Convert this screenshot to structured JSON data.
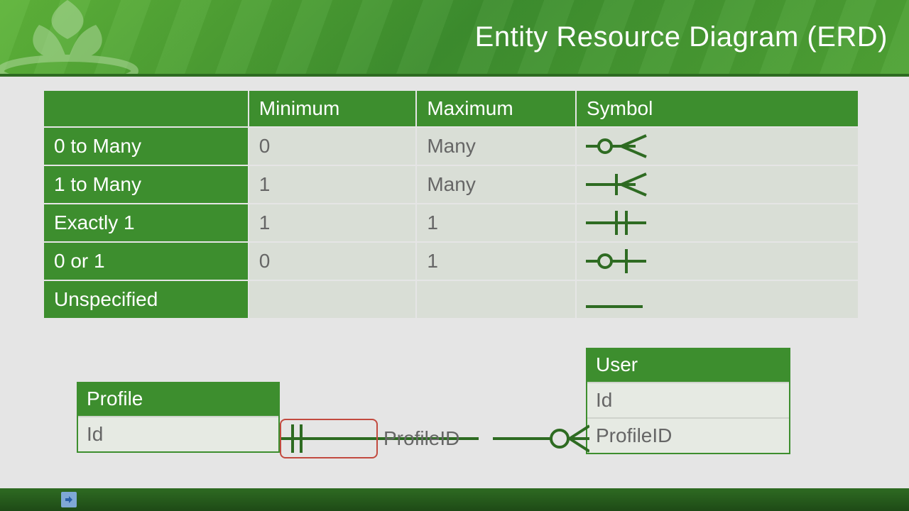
{
  "header": {
    "title": "Entity Resource Diagram (ERD)"
  },
  "table": {
    "headers": [
      "",
      "Minimum",
      "Maximum",
      "Symbol"
    ],
    "rows": [
      {
        "label": "0 to Many",
        "min": "0",
        "max": "Many",
        "symbol": "zero-to-many"
      },
      {
        "label": "1 to Many",
        "min": "1",
        "max": "Many",
        "symbol": "one-to-many"
      },
      {
        "label": "Exactly 1",
        "min": "1",
        "max": "1",
        "symbol": "exactly-one"
      },
      {
        "label": "0 or 1",
        "min": "0",
        "max": "1",
        "symbol": "zero-or-one"
      },
      {
        "label": "Unspecified",
        "min": "",
        "max": "",
        "symbol": "unspecified"
      }
    ]
  },
  "diagram": {
    "entities": {
      "profile": {
        "name": "Profile",
        "attrs": [
          "Id"
        ]
      },
      "user": {
        "name": "User",
        "attrs": [
          "Id",
          "ProfileID"
        ]
      }
    },
    "relationship": {
      "left_cardinality": "exactly-one",
      "right_cardinality": "zero-to-many",
      "mid_label": "ProfileID",
      "highlight": "left"
    }
  },
  "colors": {
    "brand_green": "#3d8e2e",
    "brand_green_light": "#5fb43a",
    "row_bg": "#d9ded6",
    "text_muted": "#666666",
    "highlight_red": "#c24a3f"
  }
}
